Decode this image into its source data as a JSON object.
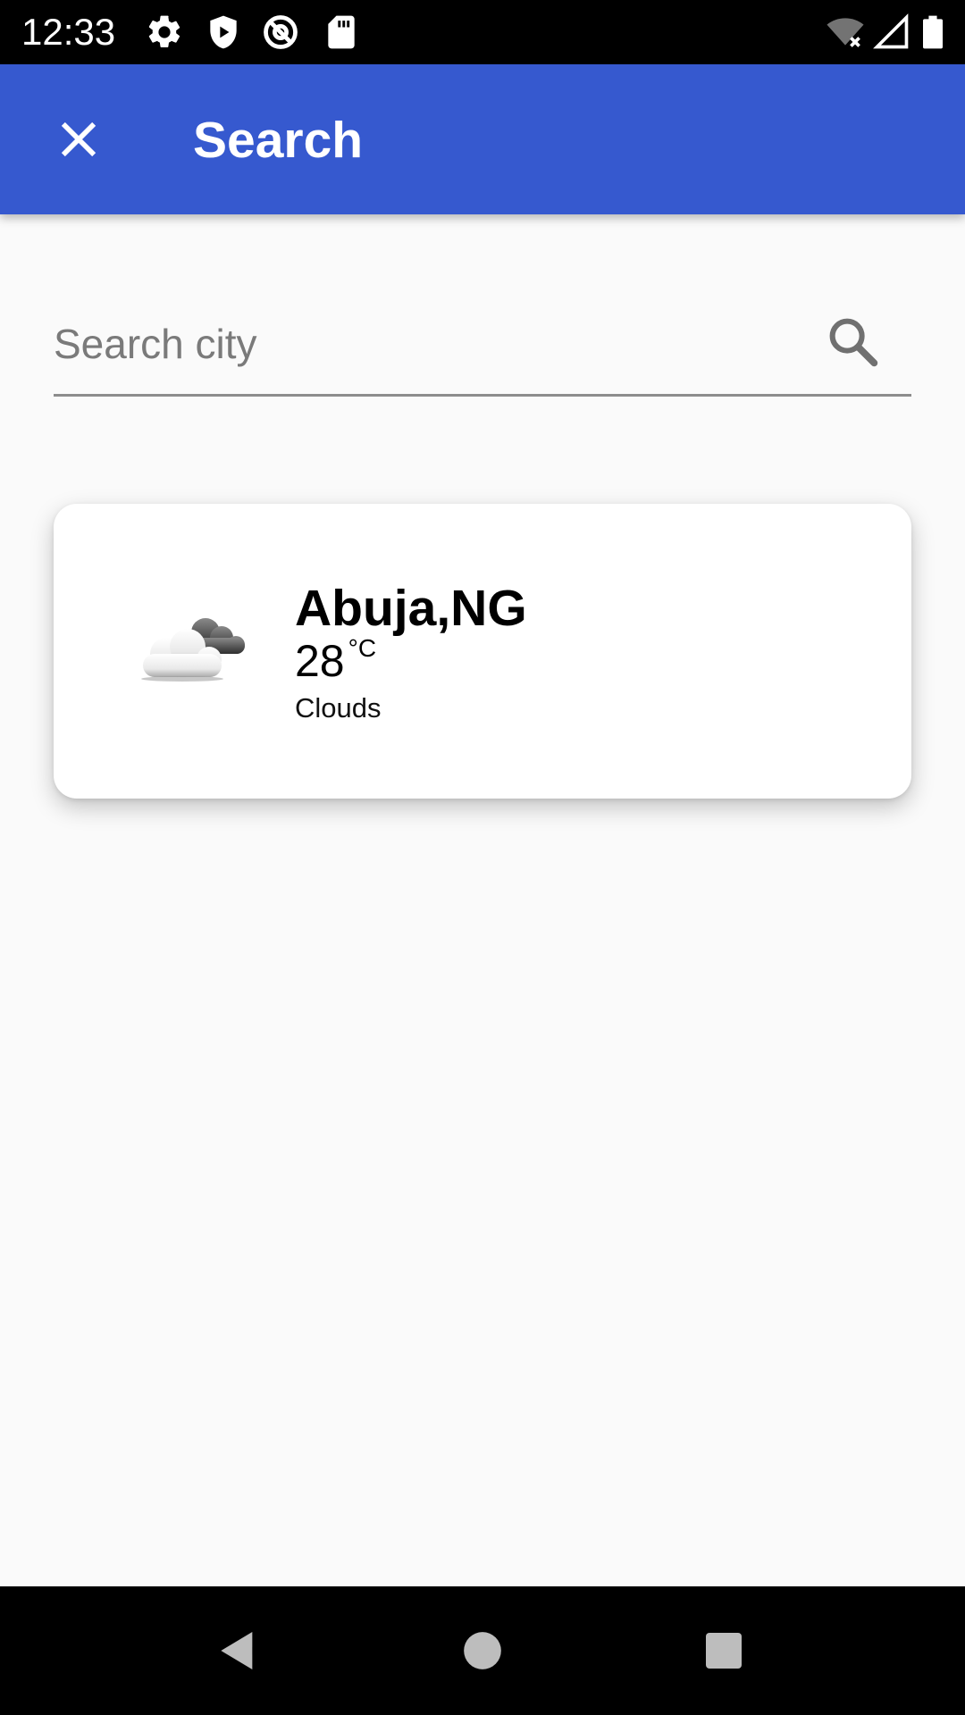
{
  "status_bar": {
    "time": "12:33",
    "left_icons": [
      "gear-icon",
      "shield-icon",
      "at-sign-icon",
      "sd-card-icon"
    ],
    "right_icons": [
      "wifi-off-icon",
      "signal-icon",
      "battery-icon"
    ]
  },
  "app_bar": {
    "title": "Search",
    "close_icon": "close-icon",
    "background_color": "#3659CF"
  },
  "search": {
    "placeholder": "Search city",
    "value": "",
    "icon": "search-icon"
  },
  "results": [
    {
      "city": "Abuja,NG",
      "temperature": "28",
      "unit": "°C",
      "condition": "Clouds",
      "icon": "clouds-icon"
    }
  ],
  "nav_bar": {
    "buttons": [
      "back-icon",
      "home-icon",
      "recents-icon"
    ]
  }
}
